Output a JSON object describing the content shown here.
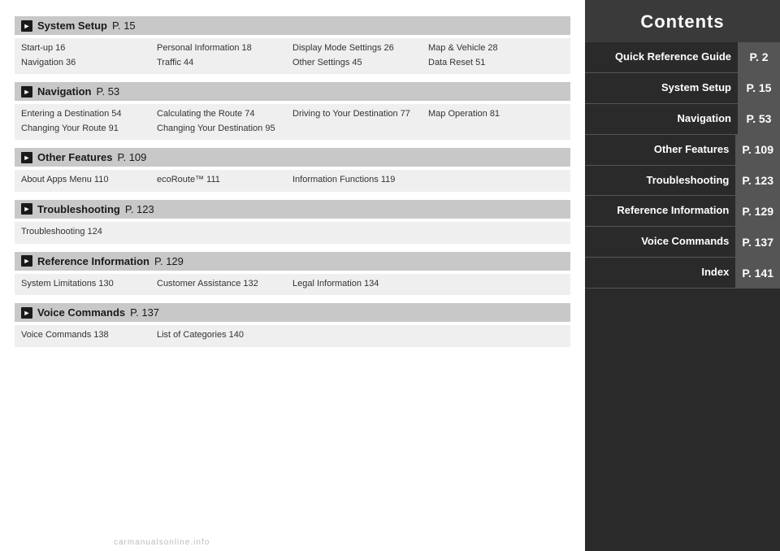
{
  "sidebar": {
    "title": "Contents",
    "items": [
      {
        "label": "Quick Reference Guide",
        "page": "P. 2",
        "active": true
      },
      {
        "label": "System Setup",
        "page": "P. 15"
      },
      {
        "label": "Navigation",
        "page": "P. 53"
      },
      {
        "label": "Other Features",
        "page": "P. 109"
      },
      {
        "label": "Troubleshooting",
        "page": "P. 123"
      },
      {
        "label": "Reference Information",
        "page": "P. 129"
      },
      {
        "label": "Voice Commands",
        "page": "P. 137"
      },
      {
        "label": "Index",
        "page": "P. 141"
      }
    ]
  },
  "sections": [
    {
      "id": "system-setup",
      "title": "System Setup",
      "page": "P. 15",
      "rows": [
        [
          {
            "items": [
              "Start-up 16",
              "Navigation 36"
            ]
          },
          {
            "items": [
              "Personal Information 18",
              "Traffic 44"
            ]
          },
          {
            "items": [
              "Display Mode Settings 26",
              "Other Settings 45"
            ]
          },
          {
            "items": [
              "Map & Vehicle 28",
              "Data Reset 51"
            ]
          }
        ]
      ]
    },
    {
      "id": "navigation",
      "title": "Navigation",
      "page": "P. 53",
      "rows": [
        [
          {
            "items": [
              "Entering a Destination 54",
              "Changing Your Route 91"
            ]
          },
          {
            "items": [
              "Calculating the Route 74",
              "Changing Your Destination 95"
            ]
          },
          {
            "items": [
              "Driving to Your Destination 77",
              ""
            ]
          },
          {
            "items": [
              "Map Operation 81",
              ""
            ]
          }
        ]
      ]
    },
    {
      "id": "other-features",
      "title": "Other Features",
      "page": "P. 109",
      "rows": [
        [
          {
            "items": [
              "About Apps Menu 110"
            ]
          },
          {
            "items": [
              "ecoRoute™ 111"
            ]
          },
          {
            "items": [
              "Information Functions 119"
            ]
          },
          {
            "items": [
              ""
            ]
          }
        ]
      ]
    },
    {
      "id": "troubleshooting",
      "title": "Troubleshooting",
      "page": "P. 123",
      "rows": [
        [
          {
            "items": [
              "Troubleshooting 124"
            ]
          },
          {
            "items": [
              ""
            ]
          },
          {
            "items": [
              ""
            ]
          },
          {
            "items": [
              ""
            ]
          }
        ]
      ]
    },
    {
      "id": "reference-information",
      "title": "Reference Information",
      "page": "P. 129",
      "rows": [
        [
          {
            "items": [
              "System Limitations 130"
            ]
          },
          {
            "items": [
              "Customer Assistance 132"
            ]
          },
          {
            "items": [
              "Legal Information 134"
            ]
          },
          {
            "items": [
              ""
            ]
          }
        ]
      ]
    },
    {
      "id": "voice-commands",
      "title": "Voice Commands",
      "page": "P. 137",
      "rows": [
        [
          {
            "items": [
              "Voice Commands 138"
            ]
          },
          {
            "items": [
              "List of Categories 140"
            ]
          },
          {
            "items": [
              ""
            ]
          },
          {
            "items": [
              ""
            ]
          }
        ]
      ]
    }
  ],
  "watermark": "carmanualsonline.info"
}
